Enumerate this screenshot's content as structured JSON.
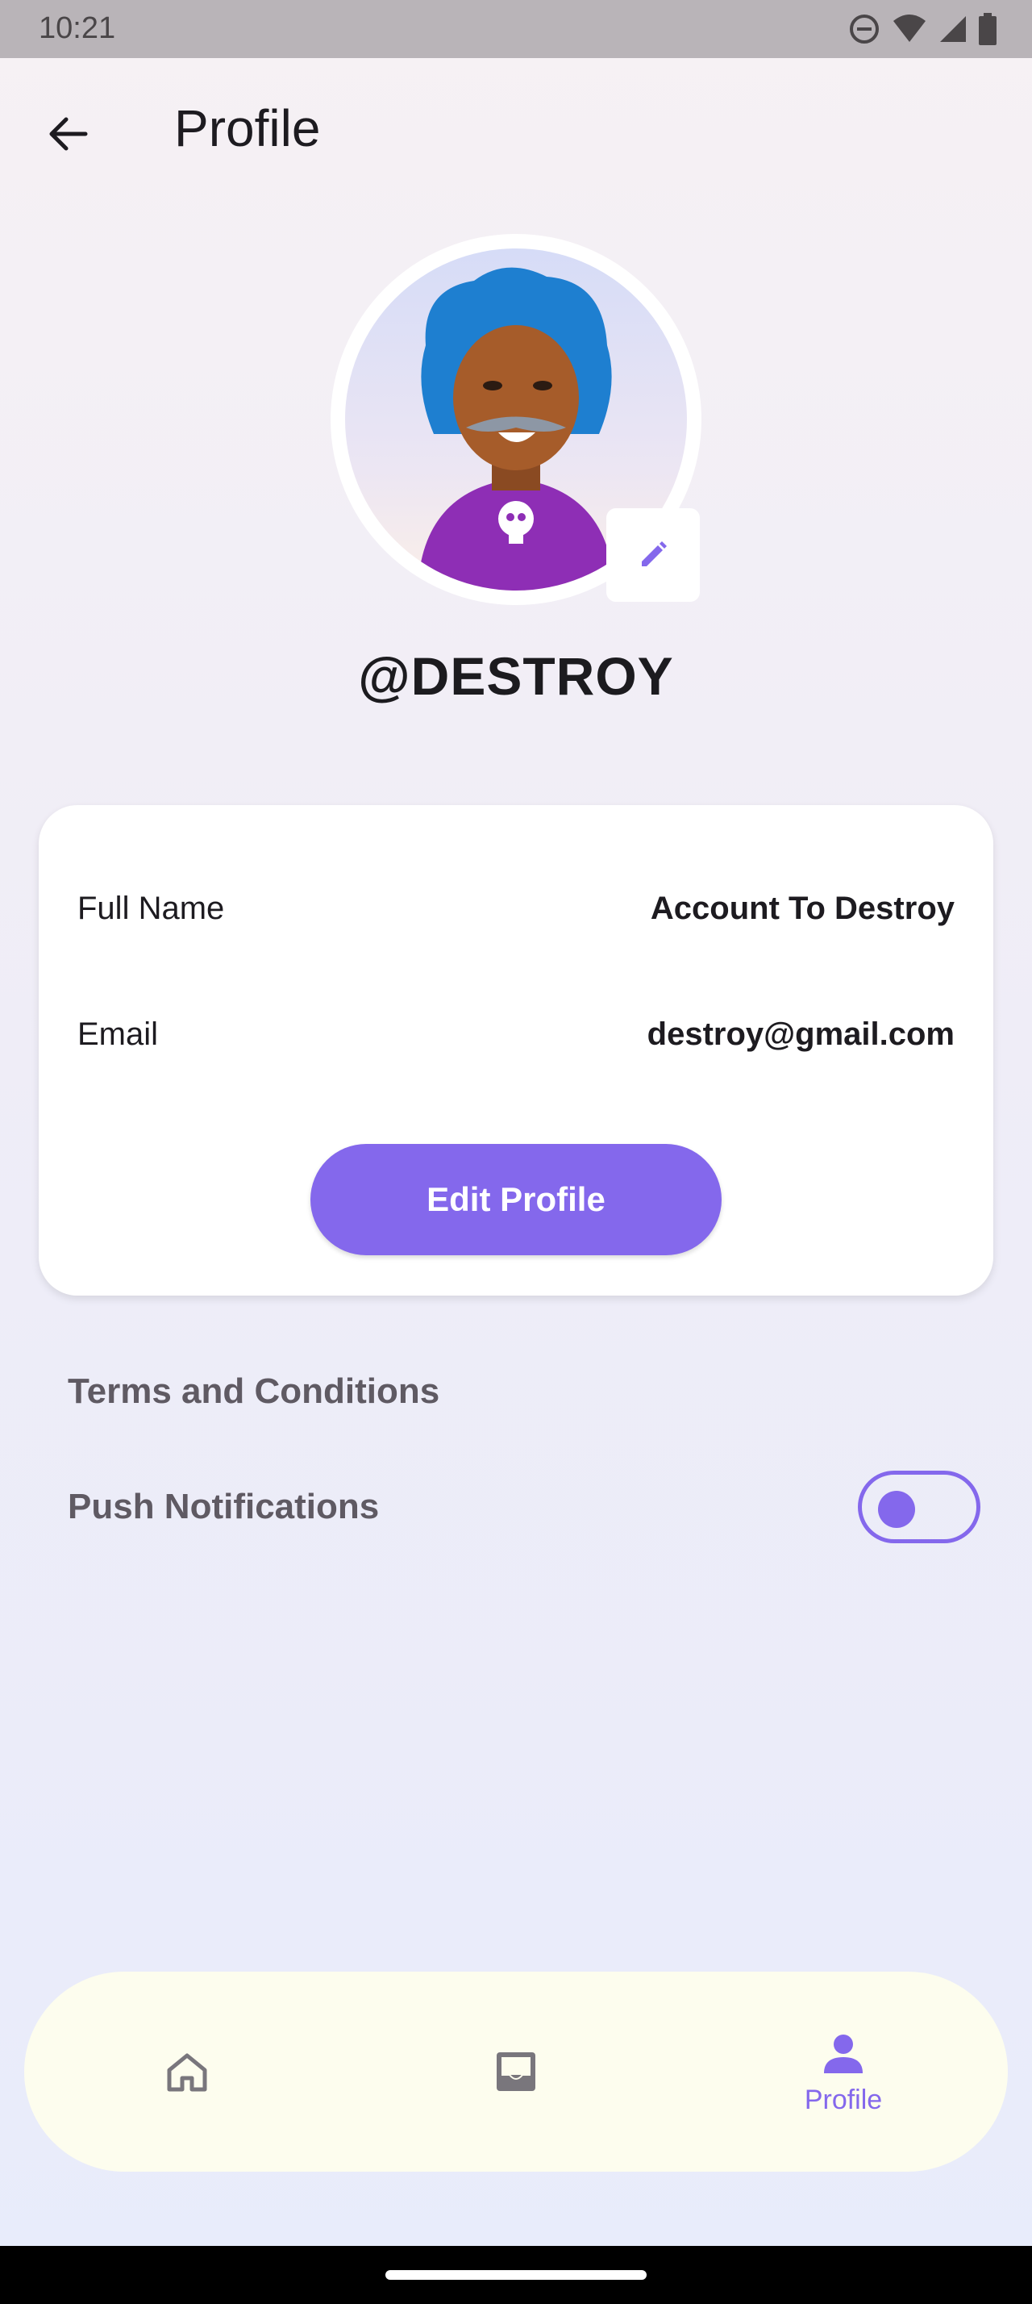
{
  "status_bar": {
    "time": "10:21"
  },
  "header": {
    "title": "Profile"
  },
  "profile": {
    "username": "@DESTROY"
  },
  "info": {
    "full_name_label": "Full Name",
    "full_name_value": "Account To Destroy",
    "email_label": "Email",
    "email_value": "destroy@gmail.com",
    "edit_button_label": "Edit Profile"
  },
  "settings": {
    "terms_label": "Terms and Conditions",
    "push_label": "Push Notifications",
    "push_enabled": false
  },
  "bottom_nav": {
    "items": [
      {
        "icon": "home-icon",
        "label": ""
      },
      {
        "icon": "inbox-icon",
        "label": ""
      },
      {
        "icon": "person-icon",
        "label": "Profile",
        "active": true
      }
    ]
  },
  "colors": {
    "accent": "#8468ec",
    "nav_bg": "#fdfdee",
    "card_bg": "#ffffff"
  }
}
